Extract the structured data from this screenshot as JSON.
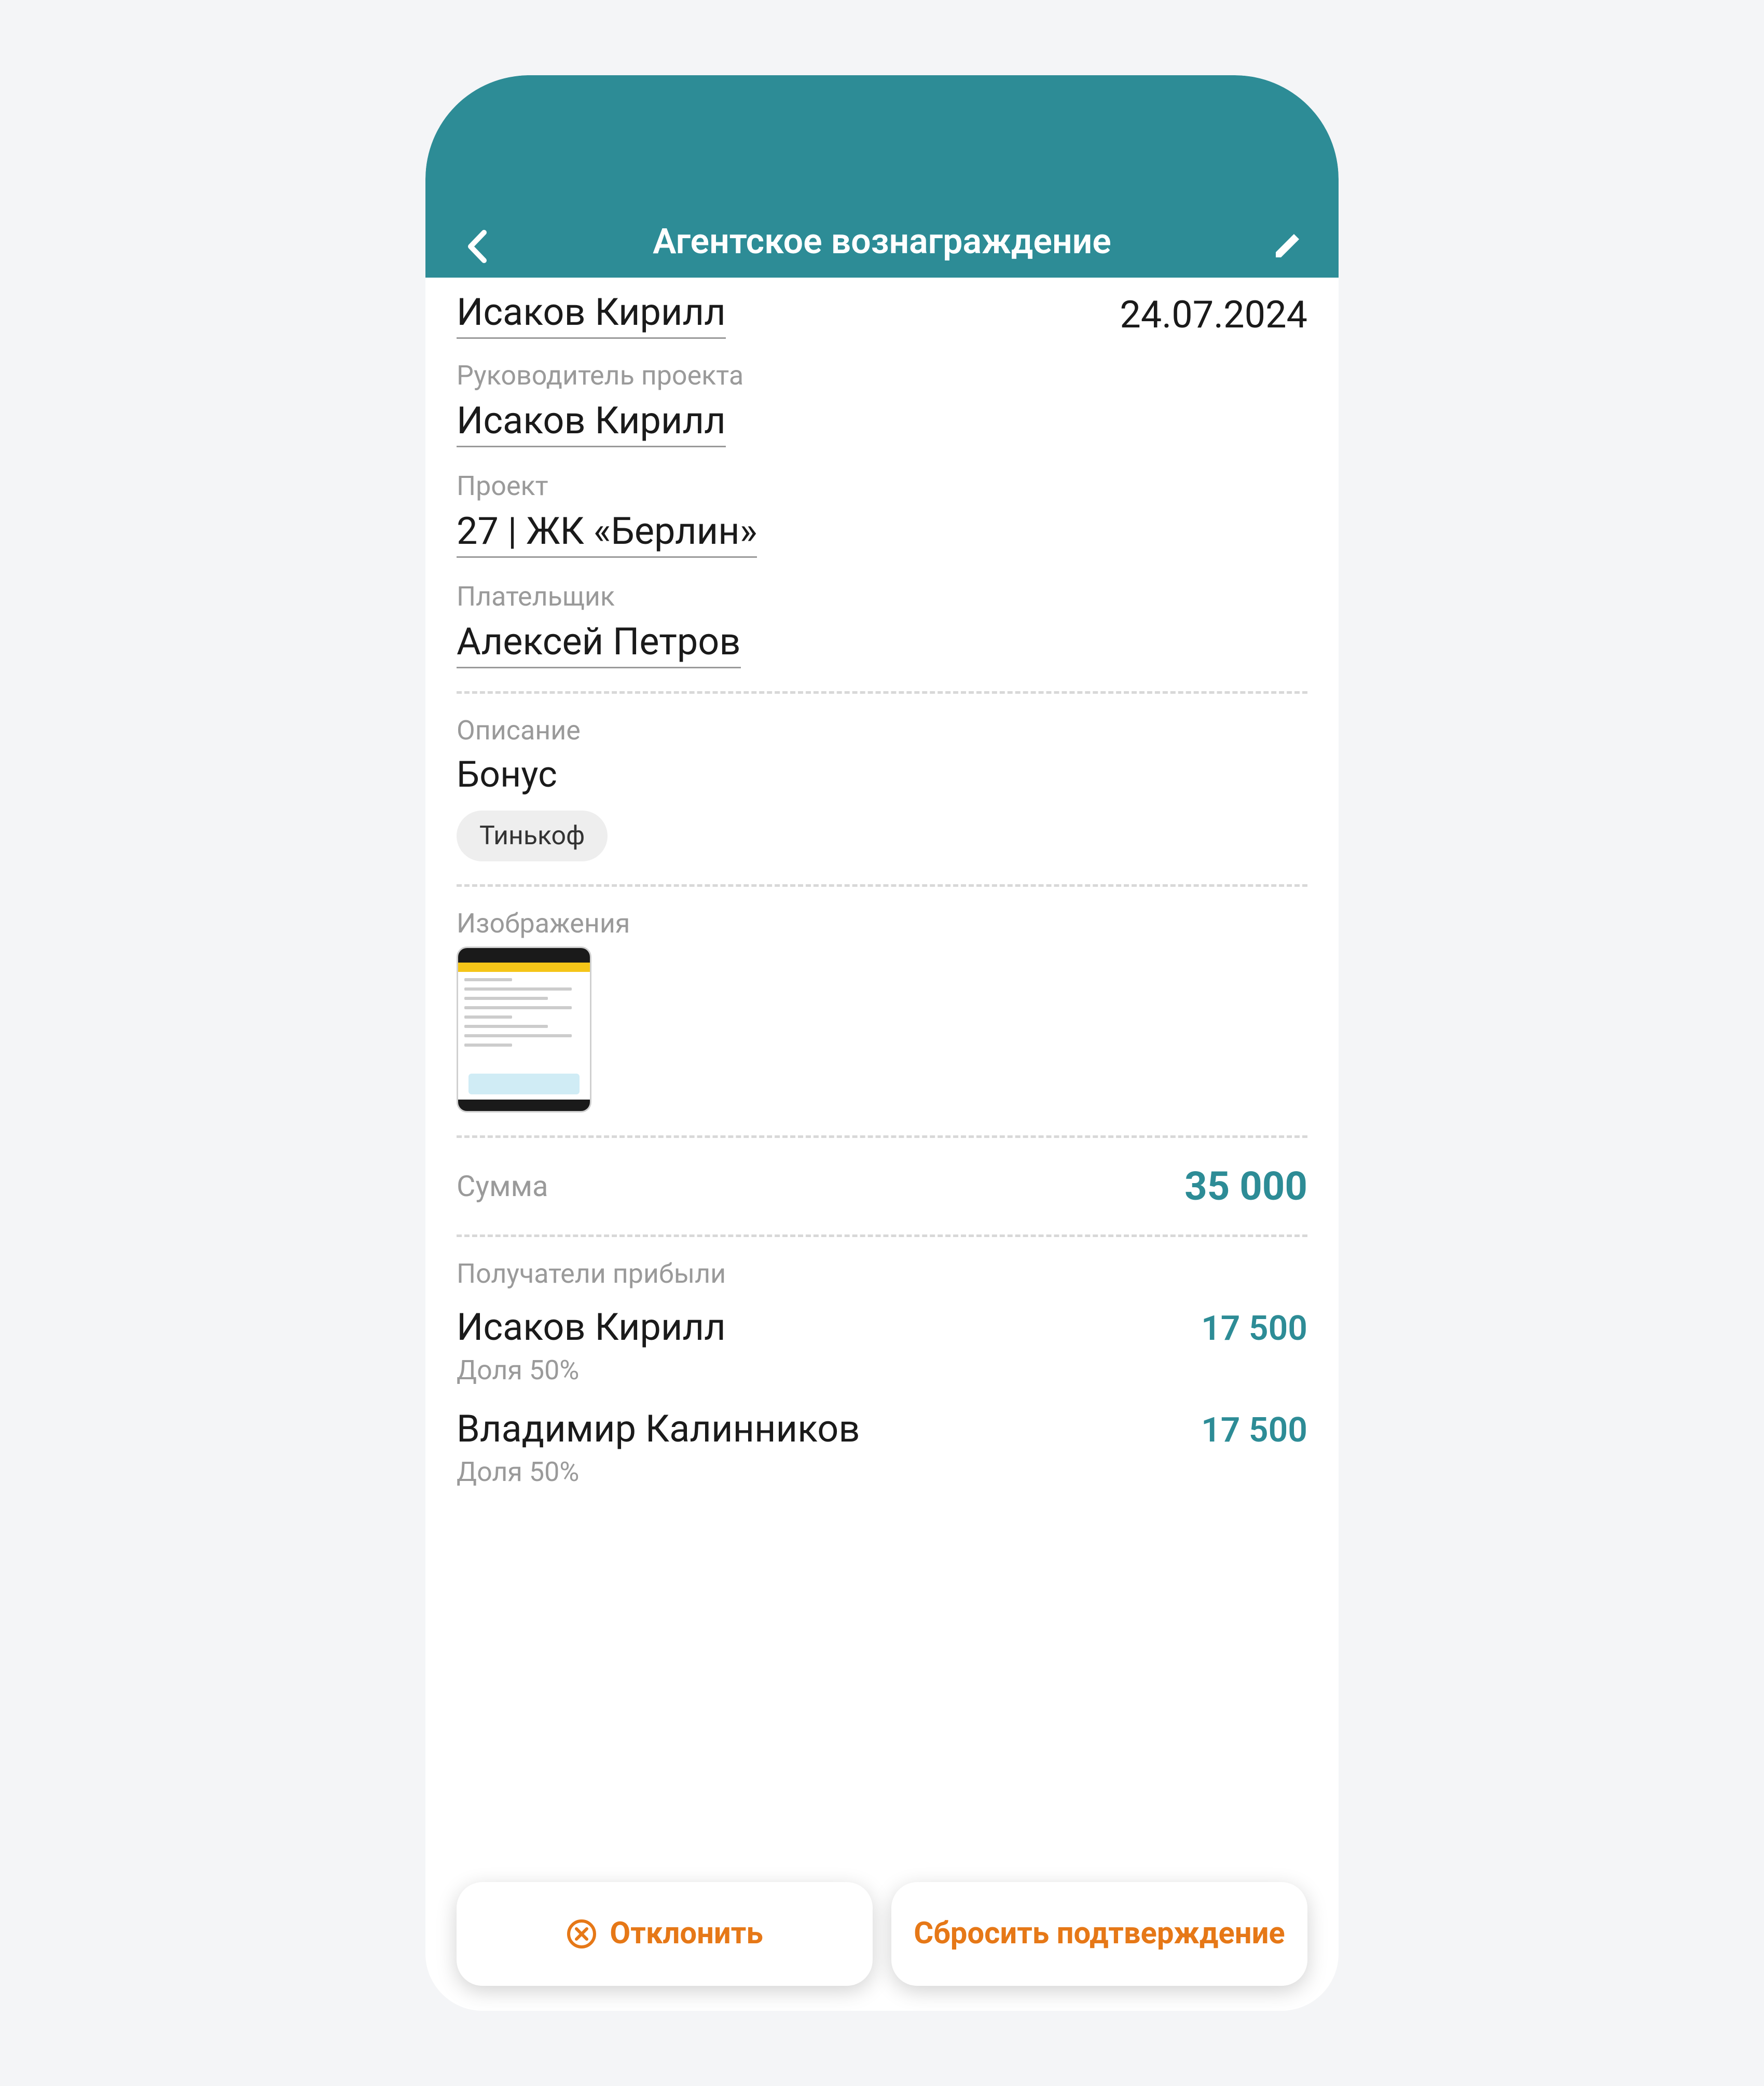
{
  "header": {
    "title": "Агентское вознаграждение"
  },
  "top": {
    "creator": "Исаков Кирилл",
    "date": "24.07.2024"
  },
  "fields": {
    "manager_label": "Руководитель проекта",
    "manager_value": "Исаков Кирилл",
    "project_label": "Проект",
    "project_value": "27 | ЖК «Берлин»",
    "payer_label": "Плательщик",
    "payer_value": "Алексей Петров"
  },
  "description": {
    "label": "Описание",
    "text": "Бонус",
    "tag": "Тинькоф"
  },
  "images": {
    "label": "Изображения"
  },
  "sum": {
    "label": "Сумма",
    "value": "35 000"
  },
  "recipients": {
    "label": "Получатели прибыли",
    "items": [
      {
        "name": "Исаков Кирилл",
        "amount": "17 500",
        "share": "Доля 50%"
      },
      {
        "name": "Владимир Калинников",
        "amount": "17 500",
        "share": "Доля 50%"
      }
    ]
  },
  "actions": {
    "reject": "Отклонить",
    "reset": "Сбросить подтверждение"
  },
  "colors": {
    "accent": "#2d8c96",
    "warning": "#e67817"
  }
}
